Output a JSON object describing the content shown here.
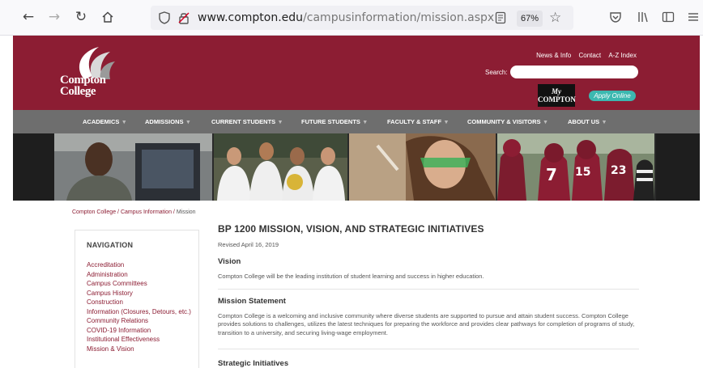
{
  "browser": {
    "url_domain": "www.compton.edu",
    "url_path": "/campusinformation/mission.aspx",
    "zoom": "67%"
  },
  "header": {
    "logo_line1": "Compton",
    "logo_line2": "College",
    "util_links": [
      "News & Info",
      "Contact",
      "A-Z Index"
    ],
    "search_label": "Search:",
    "mycompton_line1": "My",
    "mycompton_line2": "COMPTON",
    "apply_label": "Apply Online",
    "brand_color": "#8c1d33"
  },
  "main_nav": [
    "ACADEMICS",
    "ADMISSIONS",
    "CURRENT STUDENTS",
    "FUTURE STUDENTS",
    "FACULTY & STAFF",
    "COMMUNITY & VISITORS",
    "ABOUT US"
  ],
  "breadcrumb": {
    "home": "Compton College",
    "parent": "Campus Information",
    "current": "Mission",
    "sep": " / "
  },
  "sidebar": {
    "title": "NAVIGATION",
    "items": [
      "Accreditation",
      "Administration",
      "Campus Committees",
      "Campus History",
      "Construction",
      "Information (Closures, Detours, etc.)",
      "Community Relations",
      "COVID-19 Information",
      "Institutional Effectiveness",
      "Mission & Vision"
    ]
  },
  "content": {
    "title": "BP 1200 MISSION, VISION, AND STRATEGIC INITIATIVES",
    "revised": "Revised April 16, 2019",
    "vision_heading": "Vision",
    "vision_text": "Compton College will be the leading institution of student learning and success in higher education.",
    "mission_heading": "Mission Statement",
    "mission_text": "Compton College is a welcoming and inclusive community where diverse students are supported to pursue and attain student success. Compton College provides solutions to challenges, utilizes the latest techniques for preparing the workforce and provides clear pathways for completion of programs of study, transition to a university, and securing living-wage employment.",
    "initiatives_heading": "Strategic Initiatives"
  }
}
